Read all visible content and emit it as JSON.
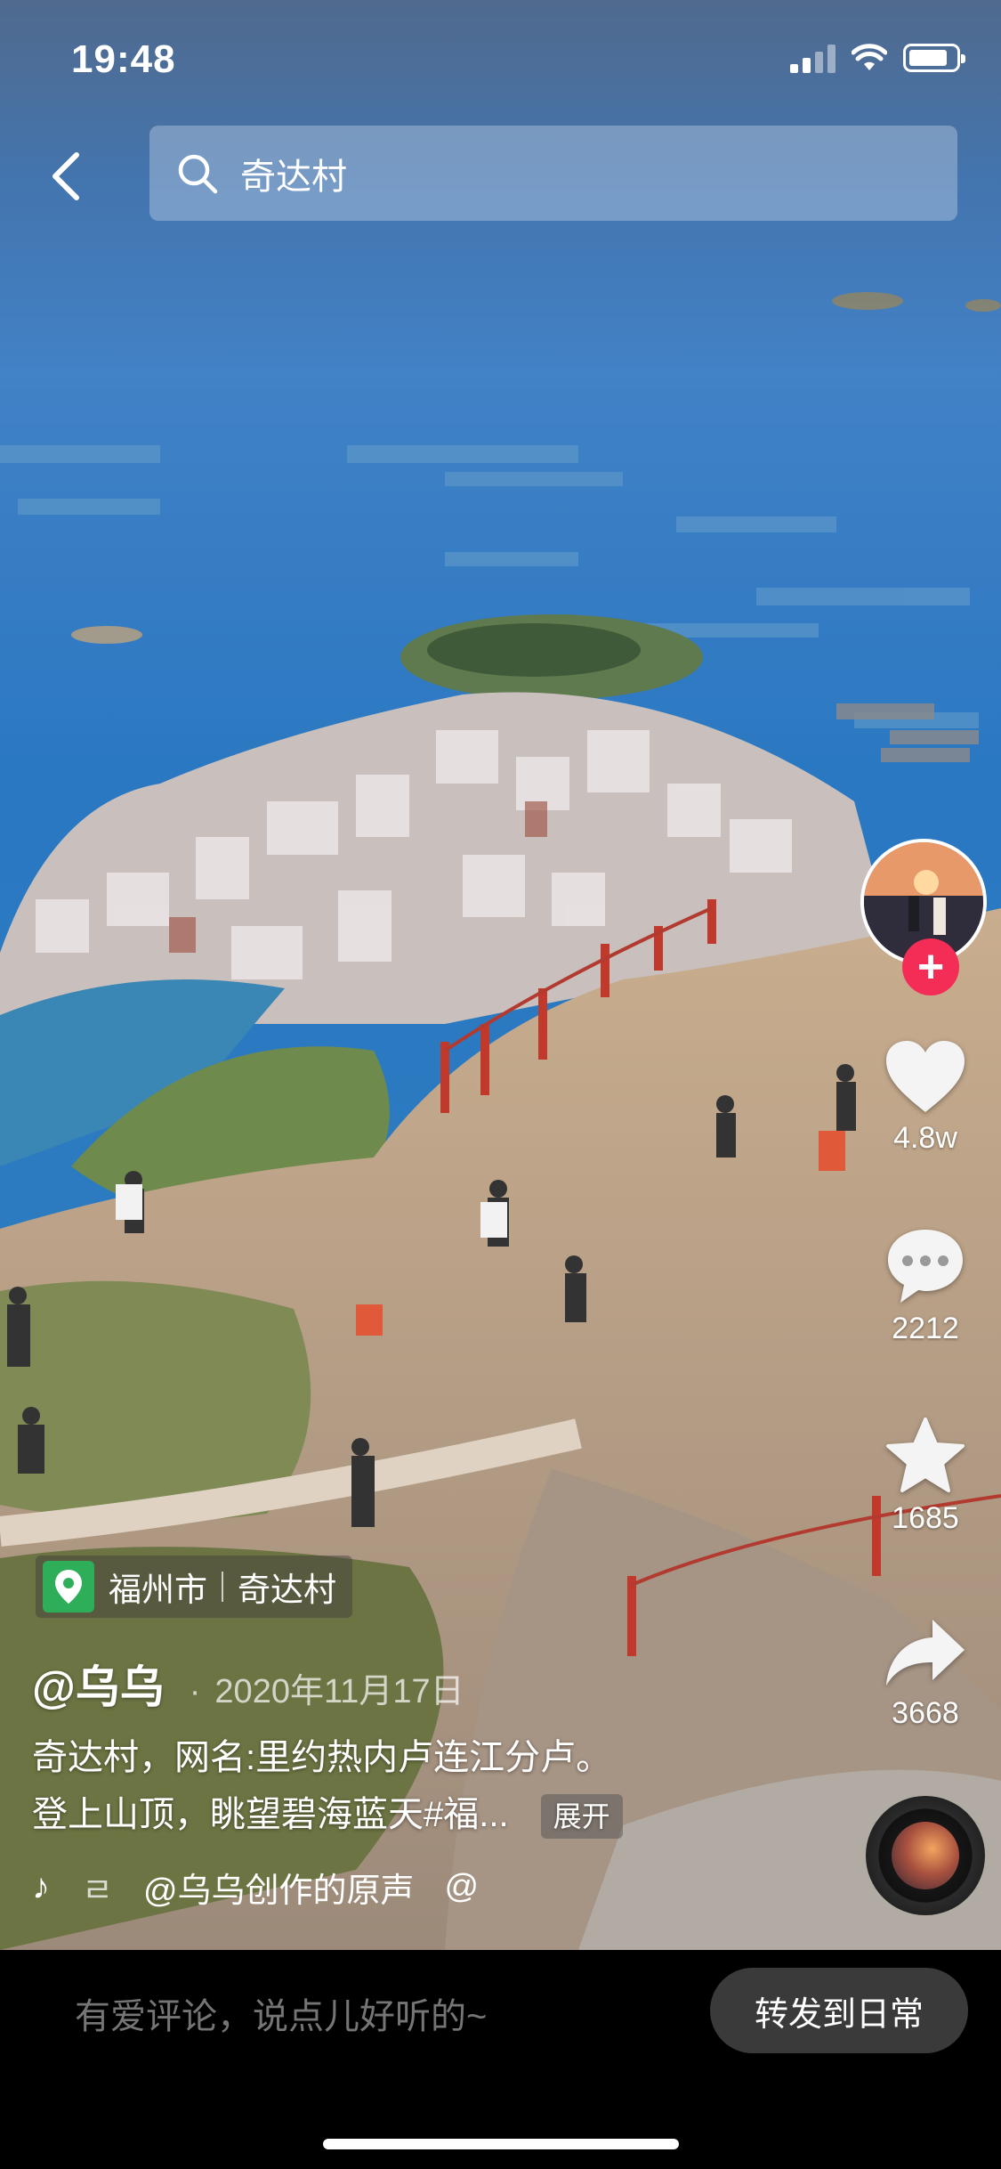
{
  "status_bar": {
    "time": "19:48"
  },
  "search": {
    "query": "奇达村"
  },
  "actions": {
    "likes": "4.8w",
    "comments": "2212",
    "favorites": "1685",
    "shares": "3668"
  },
  "post": {
    "location_city": "福州市",
    "location_place": "奇达村",
    "author": "@乌乌",
    "date": "2020年11月17日",
    "caption_line1": "奇达村，网名:里约热内卢连江分卢。",
    "caption_line2": "登上山顶，眺望碧海蓝天#福...",
    "expand_label": "展开",
    "music_partial": "ㄹ",
    "music_title": "@乌乌创作的原声",
    "music_trailing": "@"
  },
  "bottom": {
    "comment_placeholder": "有爱评论，说点儿好听的~",
    "share_label": "转发到日常"
  },
  "colors": {
    "follow": "#f42d57",
    "location_pin": "#2fae5a",
    "share_button_bg": "#3a3a3a"
  }
}
